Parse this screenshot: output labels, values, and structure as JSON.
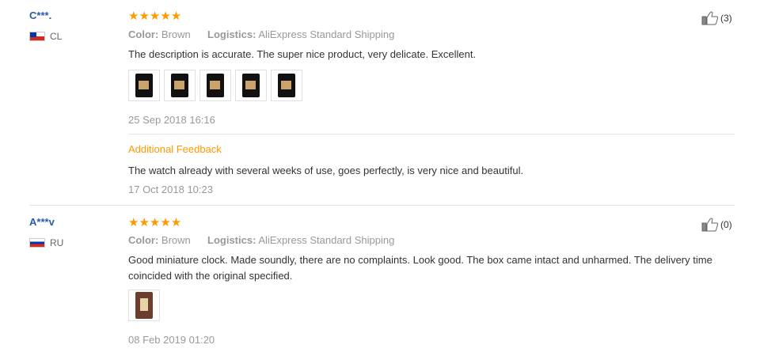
{
  "reviews": [
    {
      "user": "C***.",
      "country": "CL",
      "stars": "★★★★★",
      "rating": 5,
      "color_label": "Color:",
      "color_value": "Brown",
      "logistics_label": "Logistics:",
      "logistics_value": "AliExpress Standard Shipping",
      "text": "The description is accurate. The super nice product, very delicate. Excellent.",
      "photos_count": 5,
      "date": "25 Sep 2018 16:16",
      "additional_title": "Additional Feedback",
      "additional_text": "The watch already with several weeks of use, goes perfectly, is very nice and beautiful.",
      "additional_date": "17 Oct 2018 10:23",
      "helpful": "(3)"
    },
    {
      "user": "A***v",
      "country": "RU",
      "stars": "★★★★★",
      "rating": 5,
      "color_label": "Color:",
      "color_value": "Brown",
      "logistics_label": "Logistics:",
      "logistics_value": "AliExpress Standard Shipping",
      "text": "Good miniature clock. Made soundly, there are no complaints. Look good. The box came intact and unharmed. The delivery time coincided with the original specified.",
      "photos_count": 1,
      "date": "08 Feb 2019 01:20",
      "helpful": "(0)"
    }
  ],
  "icons": {
    "thumbs_up": "thumbs-up-icon",
    "star": "star-icon",
    "flag": "flag-icon"
  },
  "colors": {
    "star": "#ff9900",
    "username": "#2a5caa",
    "accent": "#ff9900",
    "muted": "#999999"
  }
}
